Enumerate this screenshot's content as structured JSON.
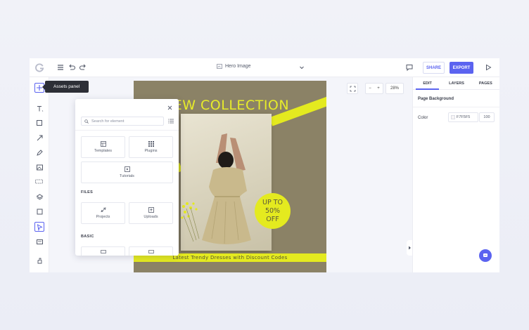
{
  "tooltip": "Assets panel",
  "topbar": {
    "document_title": "Hero Image",
    "share_label": "SHARE",
    "export_label": "EXPORT"
  },
  "zoom": {
    "value": "28%",
    "minus": "−",
    "plus": "+"
  },
  "assets": {
    "search_placeholder": "Search for element",
    "tiles": {
      "templates": "Templates",
      "plugins": "Plugins",
      "tutorials": "Tutorials",
      "projects": "Projects",
      "uploads": "Uploads"
    },
    "sections": {
      "files": "FILES",
      "basic": "BASIC"
    }
  },
  "poster": {
    "title": "NEW COLLECTION",
    "badge_line1": "UP TO",
    "badge_line2": "50%",
    "badge_line3": "OFF",
    "footer": "Latest Trendy Dresses with  Discount Codes",
    "accent_color": "#e4ea1f",
    "background_color": "#8b8266"
  },
  "right_panel": {
    "tabs": [
      "EDIT",
      "LAYERS",
      "PAGES"
    ],
    "heading": "Page Background",
    "color_label": "Color",
    "color_value": "F7F5F5",
    "opacity_value": "100"
  },
  "colors": {
    "brand": "#5b63f0"
  }
}
